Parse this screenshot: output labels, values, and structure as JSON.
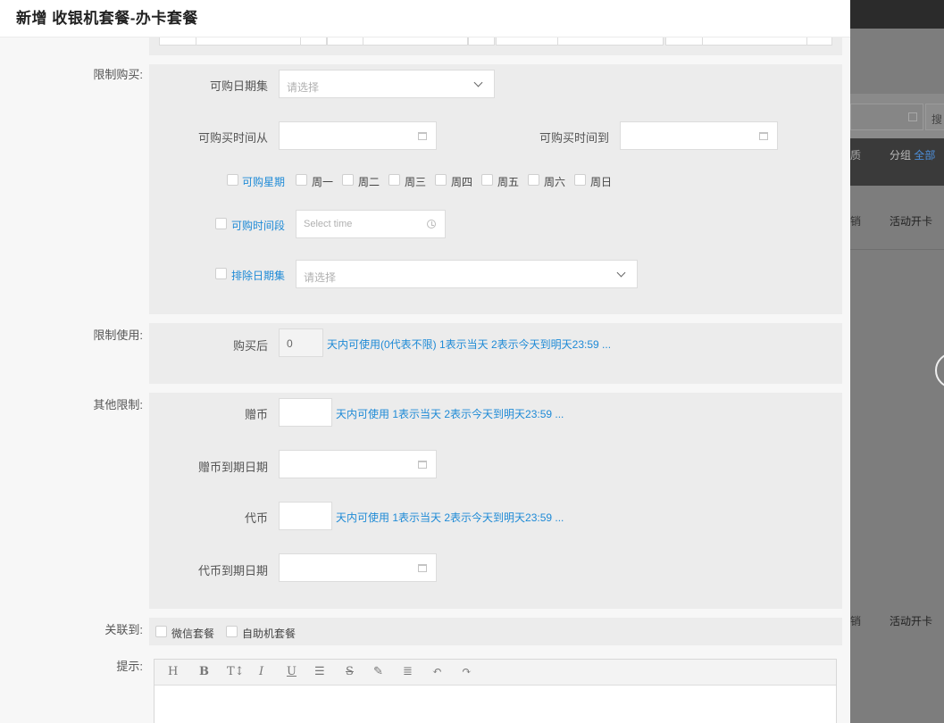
{
  "modal": {
    "title": "新增 收银机套餐-办卡套餐"
  },
  "limit_purchase": {
    "section_label": "限制购买:",
    "date_set_label": "可购日期集",
    "date_set_placeholder": "请选择",
    "time_from_label": "可购买时间从",
    "time_to_label": "可购买时间到",
    "weekday": {
      "label": "可购星期",
      "days": [
        "周一",
        "周二",
        "周三",
        "周四",
        "周五",
        "周六",
        "周日"
      ]
    },
    "time_period": {
      "label": "可购时间段",
      "placeholder": "Select time"
    },
    "exclude_dates": {
      "label": "排除日期集",
      "placeholder": "请选择"
    }
  },
  "limit_use": {
    "section_label": "限制使用:",
    "after_purchase_label": "购买后",
    "days_value": "0",
    "hint": "天内可使用(0代表不限) 1表示当天 2表示今天到明天23:59 ..."
  },
  "other_limits": {
    "section_label": "其他限制:",
    "bonus_coin_label": "赠币",
    "bonus_coin_hint": "天内可使用 1表示当天 2表示今天到明天23:59 ...",
    "bonus_coin_expiry_label": "赠币到期日期",
    "token_label": "代币",
    "token_hint": "天内可使用 1表示当天 2表示今天到明天23:59 ...",
    "token_expiry_label": "代币到期日期"
  },
  "link_to": {
    "section_label": "关联到:",
    "options": [
      "微信套餐",
      "自助机套餐"
    ]
  },
  "tips": {
    "section_label": "提示:",
    "toolbar": [
      "H",
      "B",
      "T↕",
      "I",
      "U",
      "☰",
      "S",
      "✎",
      "≣",
      "↶",
      "↷"
    ]
  },
  "background": {
    "search_button": "搜",
    "group_label": "分组",
    "group_all": "全部",
    "col_partial": "质",
    "row_partial": "销",
    "row_type": "活动开卡"
  },
  "colors": {
    "accent": "#1e8ad6",
    "section_bg": "#ececec",
    "header_text": "#222222"
  }
}
